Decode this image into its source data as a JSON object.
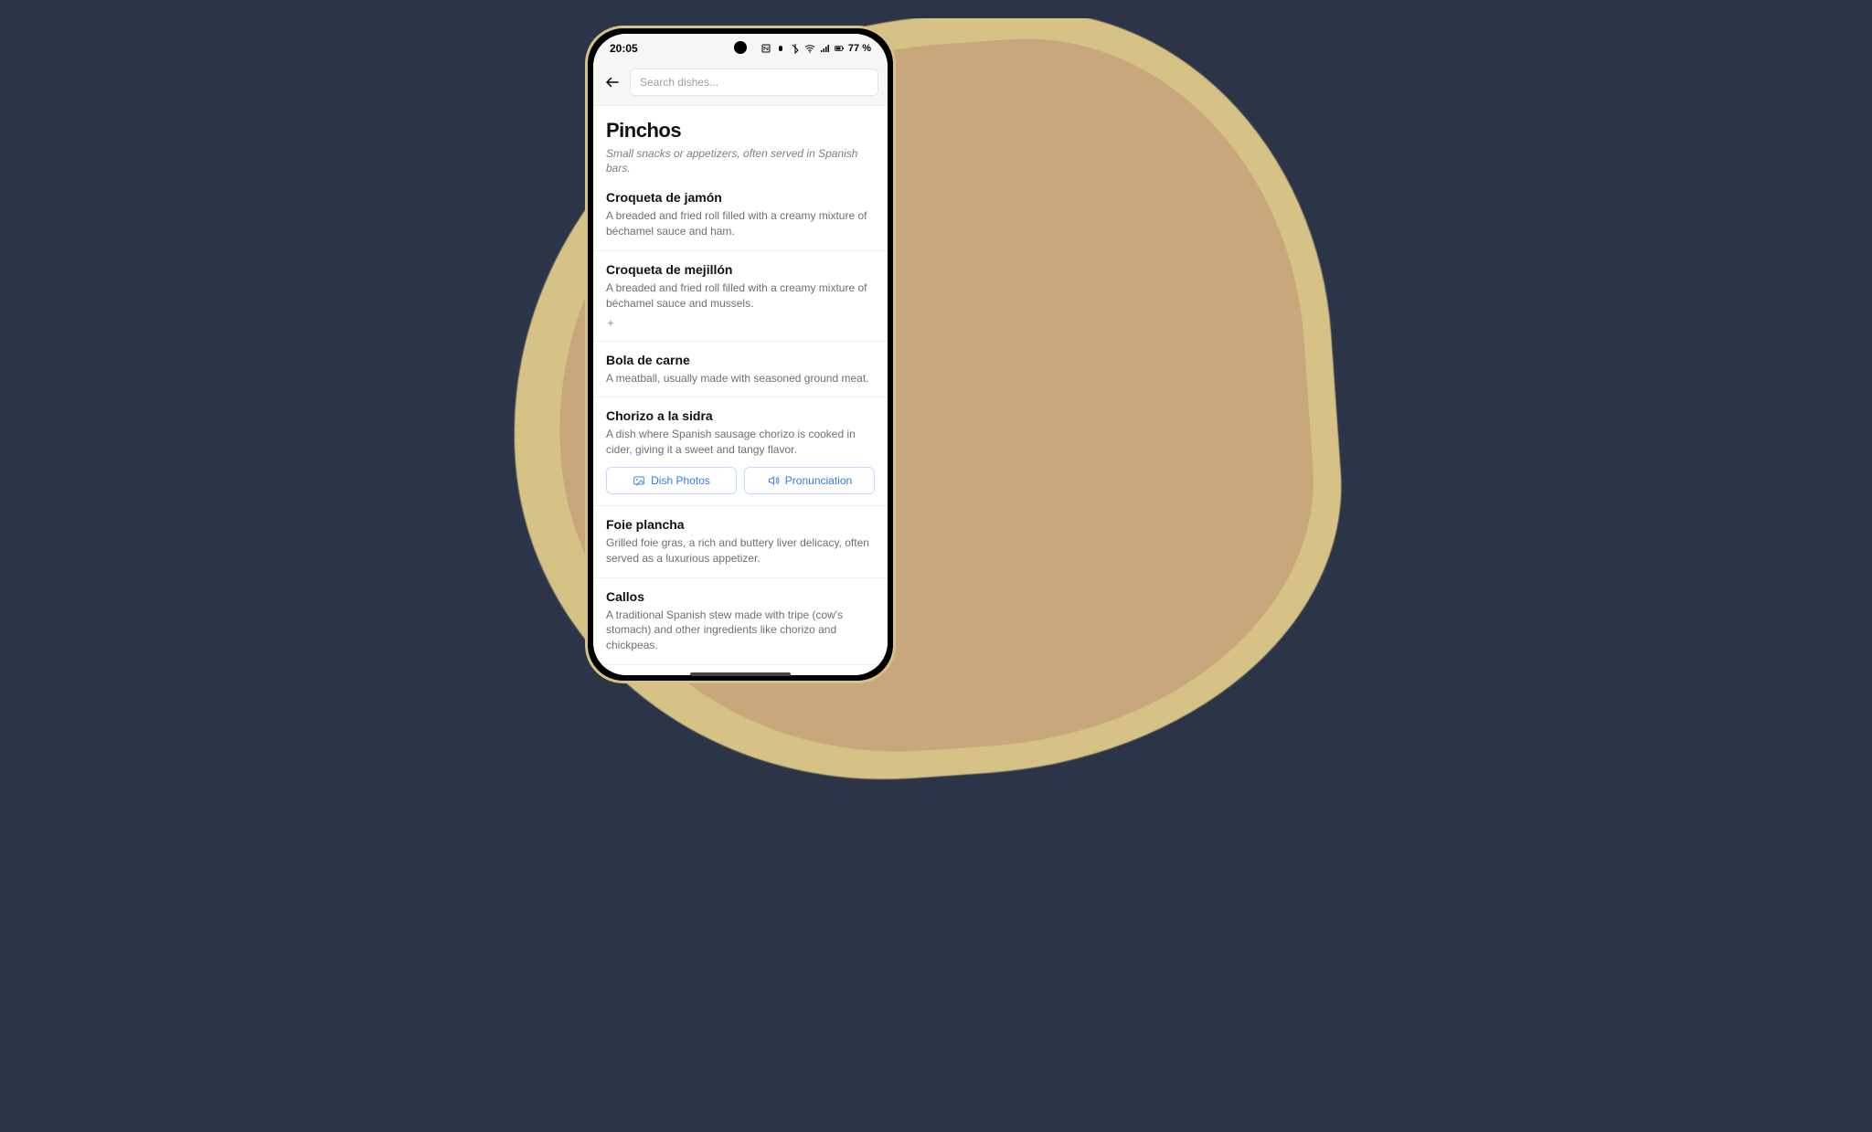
{
  "statusbar": {
    "time": "20:05",
    "battery": "77 %"
  },
  "search": {
    "placeholder": "Search dishes..."
  },
  "category": {
    "title": "Pinchos",
    "subtitle": "Small snacks or appetizers, often served in Spanish bars."
  },
  "dishes": [
    {
      "name": "Croqueta de jamón",
      "desc": "A breaded and fried roll filled with a creamy mixture of béchamel sauce and ham."
    },
    {
      "name": "Croqueta de mejillón",
      "desc": "A breaded and fried roll filled with a creamy mixture of béchamel sauce and mussels.",
      "extra": "✦"
    },
    {
      "name": "Bola de carne",
      "desc": "A meatball, usually made with seasoned ground meat."
    },
    {
      "name": "Chorizo a la sidra",
      "desc": "A dish where Spanish sausage chorizo is cooked in cider, giving it a sweet and tangy flavor.",
      "buttons": true
    },
    {
      "name": "Foie plancha",
      "desc": "Grilled foie gras, a rich and buttery liver delicacy, often served as a luxurious appetizer."
    },
    {
      "name": "Callos",
      "desc": "A traditional Spanish stew made with tripe (cow's stomach) and other ingredients like chorizo and chickpeas."
    }
  ],
  "buttons": {
    "photos": "Dish Photos",
    "pronunciation": "Pronunciation"
  }
}
